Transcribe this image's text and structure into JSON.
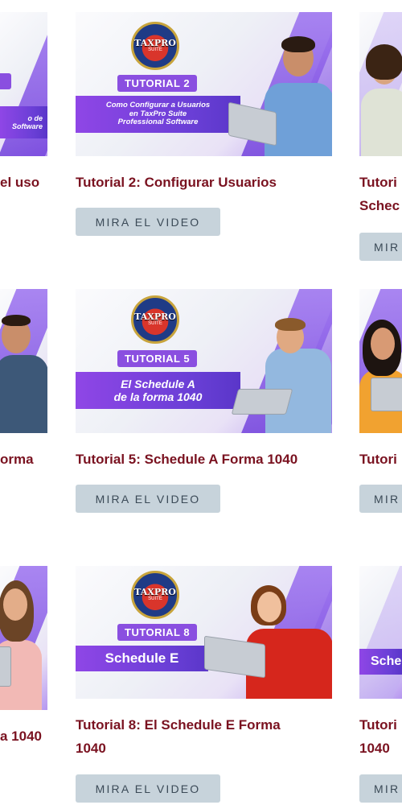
{
  "grid": {
    "row1": {
      "left": {
        "caption": "o de\nSoftware",
        "title": "el uso"
      },
      "center": {
        "logo": "TAXPRO",
        "logo_sub": "SUITE",
        "badge": "TUTORIAL 2",
        "caption": "Como Configurar a Usuarios\nen TaxPro Suite\nProfessional Software",
        "title": "Tutorial 2: Configurar Usuarios",
        "button": "MIRA EL VIDEO"
      },
      "right": {
        "title_line1": "Tutori",
        "title_line2": "Schec",
        "button": "MIR"
      }
    },
    "row2": {
      "left": {
        "title": "orma"
      },
      "center": {
        "logo": "TAXPRO",
        "logo_sub": "SUITE",
        "badge": "TUTORIAL 5",
        "caption": "El Schedule A\nde la forma 1040",
        "title": "Tutorial 5: Schedule A Forma 1040",
        "button": "MIRA EL VIDEO"
      },
      "right": {
        "title": "Tutori",
        "button": "MIR"
      }
    },
    "row3": {
      "left": {
        "title": "a 1040"
      },
      "center": {
        "logo": "TAXPRO",
        "logo_sub": "SUITE",
        "badge": "TUTORIAL 8",
        "caption": "Schedule E",
        "title_line1": "Tutorial 8: El Schedule E Forma",
        "title_line2": "1040",
        "button": "MIRA EL VIDEO"
      },
      "right": {
        "caption": "Sche",
        "title_line1": "Tutori",
        "title_line2": "1040",
        "button": "MIR"
      }
    }
  },
  "colors": {
    "title": "#7a1220",
    "button_bg": "#c7d3db",
    "accent_purple": "#8a4fe0"
  }
}
